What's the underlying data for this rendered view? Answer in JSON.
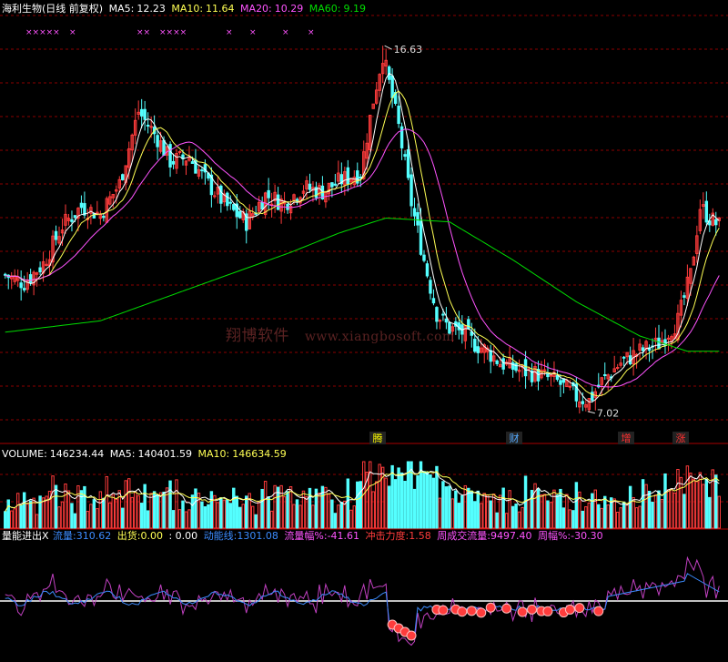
{
  "colors": {
    "up": "#ff3c3c",
    "down": "#54ffff",
    "ma5": "#ffffff",
    "ma10": "#ffff54",
    "ma20": "#ff54ff",
    "ma60": "#00dd00",
    "grid": "#8b0000",
    "blue": "#3c8cff"
  },
  "panel1": {
    "title": "海利生物(日线 前复权)",
    "ma5_label": "MA5:",
    "ma5_value": "12.23",
    "ma10_label": "MA10:",
    "ma10_value": "11.64",
    "ma20_label": "MA20:",
    "ma20_value": "10.29",
    "ma60_label": "MA60:",
    "ma60_value": "9.19",
    "high_label": "16.63",
    "low_label": "7.02",
    "markers": [
      "腾",
      "财",
      "增",
      "涨"
    ],
    "x_marks": [
      "×××××",
      "×",
      "××",
      "××××",
      "×",
      "×",
      "×",
      "×"
    ]
  },
  "panel2": {
    "volume_label": "VOLUME:",
    "volume_value": "146234.44",
    "ma5_label": "MA5:",
    "ma5_value": "140401.59",
    "ma10_label": "MA10:",
    "ma10_value": "146634.59"
  },
  "panel3": {
    "title": "量能进出X",
    "flow_label": "流量:",
    "flow_value": "310.62",
    "out_label": "出货:",
    "out_value": "0.00",
    "sep_value": ": 0.00",
    "kinetic_label": "动能线:",
    "kinetic_value": "1301.08",
    "flow_pct_label": "流量幅%:",
    "flow_pct_value": "-41.61",
    "impact_label": "冲击力度:",
    "impact_value": "1.58",
    "week_flow_label": "周成交流量:",
    "week_flow_value": "9497.40",
    "week_pct_label": "周幅%:",
    "week_pct_value": "-30.30"
  },
  "watermark": {
    "cn": "翔博软件",
    "url": "www.xiangbosoft.com"
  },
  "chart_data": {
    "type": "candlestick",
    "title": "海利生物(日线 前复权)",
    "price_high": 16.63,
    "price_low": 7.02,
    "ma_values": {
      "MA5": 12.23,
      "MA10": 11.64,
      "MA20": 10.29,
      "MA60": 9.19
    },
    "volume": {
      "VOLUME": 146234.44,
      "MA5": 140401.59,
      "MA10": 146634.59
    },
    "indicator": {
      "流量": 310.62,
      "出货": 0.0,
      "动能线": 1301.08,
      "流量幅%": -41.61,
      "冲击力度": 1.58,
      "周成交流量": 9497.4,
      "周幅%": -30.3
    },
    "close_path": [
      [
        0,
        10.6
      ],
      [
        6,
        10.4
      ],
      [
        12,
        10.9
      ],
      [
        18,
        11.9
      ],
      [
        24,
        12.4
      ],
      [
        30,
        12.2
      ],
      [
        36,
        13.0
      ],
      [
        42,
        14.9
      ],
      [
        48,
        14.2
      ],
      [
        52,
        13.6
      ],
      [
        58,
        13.7
      ],
      [
        64,
        13.0
      ],
      [
        70,
        12.4
      ],
      [
        76,
        12.0
      ],
      [
        82,
        12.7
      ],
      [
        88,
        12.5
      ],
      [
        94,
        12.9
      ],
      [
        100,
        12.8
      ],
      [
        106,
        13.1
      ],
      [
        112,
        13.3
      ],
      [
        116,
        15.2
      ],
      [
        119,
        16.4
      ],
      [
        124,
        14.5
      ],
      [
        128,
        12.5
      ],
      [
        132,
        11.0
      ],
      [
        136,
        9.6
      ],
      [
        140,
        9.2
      ],
      [
        144,
        9.1
      ],
      [
        148,
        8.8
      ],
      [
        152,
        8.6
      ],
      [
        156,
        8.3
      ],
      [
        162,
        8.1
      ],
      [
        168,
        8.0
      ],
      [
        174,
        7.8
      ],
      [
        180,
        7.4
      ],
      [
        184,
        7.3
      ],
      [
        188,
        7.8
      ],
      [
        194,
        8.3
      ],
      [
        200,
        8.6
      ],
      [
        206,
        8.8
      ],
      [
        212,
        9.4
      ],
      [
        216,
        10.6
      ],
      [
        219,
        12.4
      ],
      [
        222,
        12.1
      ],
      [
        225,
        11.9
      ]
    ],
    "ma60_path": [
      [
        0,
        9.1
      ],
      [
        30,
        9.4
      ],
      [
        60,
        10.3
      ],
      [
        90,
        11.2
      ],
      [
        105,
        11.7
      ],
      [
        120,
        12.1
      ],
      [
        140,
        12.0
      ],
      [
        160,
        11.0
      ],
      [
        180,
        9.9
      ],
      [
        200,
        9.0
      ],
      [
        215,
        8.6
      ],
      [
        225,
        8.6
      ]
    ]
  }
}
